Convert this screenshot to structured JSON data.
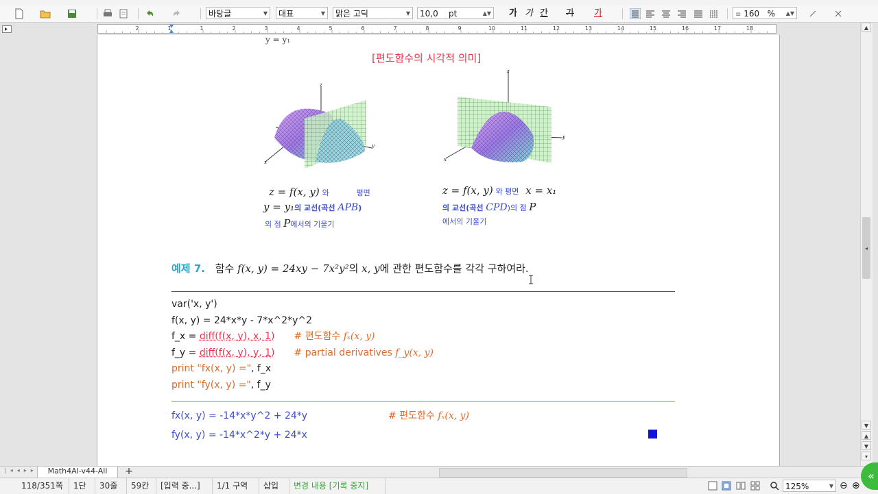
{
  "toolbar": {
    "style_value": "바탕글",
    "ruleset_value": "대표",
    "font_value": "맑은 고딕",
    "size_value": "10,0",
    "size_unit": "pt",
    "bold_label": "가",
    "italic_label": "가",
    "underline_label": "간",
    "strike_label": "가",
    "fontcolor_label": "가",
    "zoom_value": "160",
    "zoom_unit": "%"
  },
  "ruler": {
    "ticks": [
      "2",
      "1",
      "1",
      "2",
      "3",
      "4",
      "5",
      "6",
      "7",
      "8",
      "9",
      "10",
      "11",
      "12",
      "13",
      "14",
      "15",
      "16",
      "17",
      "18"
    ]
  },
  "doc": {
    "top_fragment": "y = y₁",
    "section_title": "[편도함수의 시각적 의미]",
    "fig1": {
      "cap_line1_a": "z = f(x, y)",
      "cap_line1_b": "와",
      "cap_line1_c": "평면",
      "cap_line2_a": "y = y₁",
      "cap_line2_b": "의 교선(곡선 ",
      "cap_line2_c": "APB",
      "cap_line2_d": ")",
      "cap_line3_a": "의 점 ",
      "cap_line3_b": "P",
      "cap_line3_c": "에서의 기울기"
    },
    "fig2": {
      "cap_line1_a": "z = f(x, y)",
      "cap_line1_b": "와 평면",
      "cap_line1_c": "x = x₁",
      "cap_line2_a": "의 교선(곡선 ",
      "cap_line2_b": "CPD",
      "cap_line2_c": ")의 점 ",
      "cap_line2_d": "P",
      "cap_line3": "에서의 기울기"
    },
    "example_label": "예제 7.",
    "example_text_a": "함수 ",
    "example_formula": "f(x, y) = 24xy − 7x²y²",
    "example_text_b": "의 ",
    "example_vars": "x, y",
    "example_text_c": "에 관한 편도함수를 각각 구하여라.",
    "code": {
      "line1": "var('x, y')",
      "line2": "f(x, y) = 24*x*y - 7*x^2*y^2",
      "line3_a": "f_x = ",
      "line3_b": "diff(f(x, y), x, 1)",
      "line3_c": "# 편도함수 ",
      "line3_d": "fₓ(x, y)",
      "line4_a": "f_y = ",
      "line4_b": "diff(f(x, y), y, 1)",
      "line4_c": "# partial derivatives ",
      "line4_d": "f_y(x, y)",
      "line5_a": "print ",
      "line5_b": "\"fx(x, y) =\"",
      "line5_c": ", f_x",
      "line6_a": "print ",
      "line6_b": "\"fy(x, y) =\"",
      "line6_c": ", f_y"
    },
    "output": {
      "line1": "fx(x, y) = -14*x*y^2 + 24*y",
      "line1_comment": "# 편도함수 ",
      "line1_comment_b": "fₓ(x, y)",
      "line2": "fy(x, y) = -14*x^2*y + 24*x"
    }
  },
  "tabs": {
    "active": "Math4AI-v44-All",
    "add": "+"
  },
  "status": {
    "page": "118/351쪽",
    "section": "1단",
    "line": "30줄",
    "col": "59칸",
    "input": "[입력 중...]",
    "area": "1/1 구역",
    "mode": "삽입",
    "track": "변경 내용 [기록 중지]",
    "zoom": "125%"
  },
  "colors": {
    "accent_red": "#e8354b",
    "accent_blue": "#3b4bd8",
    "example_blue": "#2aa6c8",
    "comment_orange": "#e06a2a",
    "green_fab": "#3dbb3d"
  }
}
